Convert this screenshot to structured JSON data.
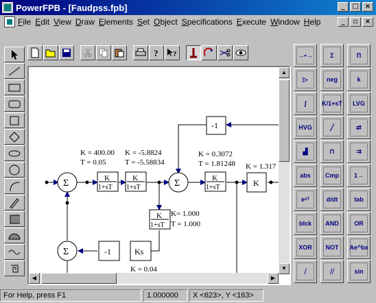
{
  "window": {
    "title": "PowerFPB - [Faudpss.fpb]"
  },
  "menu": [
    "File",
    "Edit",
    "View",
    "Draw",
    "Elements",
    "Set",
    "Object",
    "Specifications",
    "Execute",
    "Window",
    "Help"
  ],
  "toolbar": {
    "icons": [
      "new-file-icon",
      "open-folder-icon",
      "save-icon",
      "cut-icon",
      "copy-icon",
      "paste-icon",
      "print-icon",
      "help-icon",
      "context-help-icon",
      "wire-tool-icon",
      "rotate-icon",
      "scissors-icon",
      "view-icon"
    ]
  },
  "left_tools": [
    "select-arrow-icon",
    "line-icon",
    "rectangle-icon",
    "rounded-rectangle-icon",
    "square-icon",
    "diamond-icon",
    "ellipse-icon",
    "circle-icon",
    "arc-icon",
    "freehand-icon",
    "quarter-shape-icon",
    "half-circle-icon",
    "wave-icon",
    "spiral-icon"
  ],
  "palette": [
    {
      "label": "→•→",
      "name": "node-block"
    },
    {
      "label": "Σ",
      "name": "summation-block"
    },
    {
      "label": "Π",
      "name": "product-block"
    },
    {
      "label": "▷",
      "name": "gain-block"
    },
    {
      "label": "neg",
      "name": "negation-block"
    },
    {
      "label": "k",
      "name": "constant-block"
    },
    {
      "label": "∫",
      "name": "integrator-block"
    },
    {
      "label": "K/1+sT",
      "name": "lag-block"
    },
    {
      "label": "LVG",
      "name": "low-value-gate-block"
    },
    {
      "label": "HVG",
      "name": "high-value-gate-block"
    },
    {
      "label": "╱",
      "name": "limiter-block"
    },
    {
      "label": "⇄",
      "name": "switch-block"
    },
    {
      "label": "▟",
      "name": "step-block"
    },
    {
      "label": "⊓",
      "name": "pulse-block"
    },
    {
      "label": "⇉",
      "name": "selector-block"
    },
    {
      "label": "abs",
      "name": "abs-block"
    },
    {
      "label": "Cmp",
      "name": "compare-block"
    },
    {
      "label": "1→",
      "name": "output-block"
    },
    {
      "label": "eˢᵀ",
      "name": "delay-block"
    },
    {
      "label": "d/dt",
      "name": "derivative-block"
    },
    {
      "label": "tab",
      "name": "table-block"
    },
    {
      "label": "blck",
      "name": "subsystem-block"
    },
    {
      "label": "AND",
      "name": "and-gate-block"
    },
    {
      "label": "OR",
      "name": "or-gate-block"
    },
    {
      "label": "XOR",
      "name": "xor-gate-block"
    },
    {
      "label": "NOT",
      "name": "not-gate-block"
    },
    {
      "label": "Ae^bx",
      "name": "exponential-block"
    },
    {
      "label": "⧸",
      "name": "ramp-block"
    },
    {
      "label": "⧸⧸",
      "name": "rate-limiter-block"
    },
    {
      "label": "sin",
      "name": "sine-block"
    }
  ],
  "diagram": {
    "sum_symbol": "Σ",
    "lag_num": "K",
    "lag_den": "1+sT",
    "blocks": {
      "lag1_K": "K = 400.00",
      "lag1_T": "T = 0.05",
      "lag2_K": "K = -5.8824",
      "lag2_T": "T = -5.58834",
      "lag3_K": "K = 0.3072",
      "lag3_T": "T = 1.81248",
      "gain_K": "K = 1.317",
      "gain_label": "K",
      "lag4_K": "K= 1.000",
      "lag4_T": "T = 1.000",
      "neg_top": "-1",
      "neg_bottom": "-1",
      "ks_label": "Ks",
      "ks_K": "K = 0.04"
    }
  },
  "status": {
    "help": "For Help, press F1",
    "value": "1.000000",
    "coords": "X <623>, Y <163>"
  }
}
